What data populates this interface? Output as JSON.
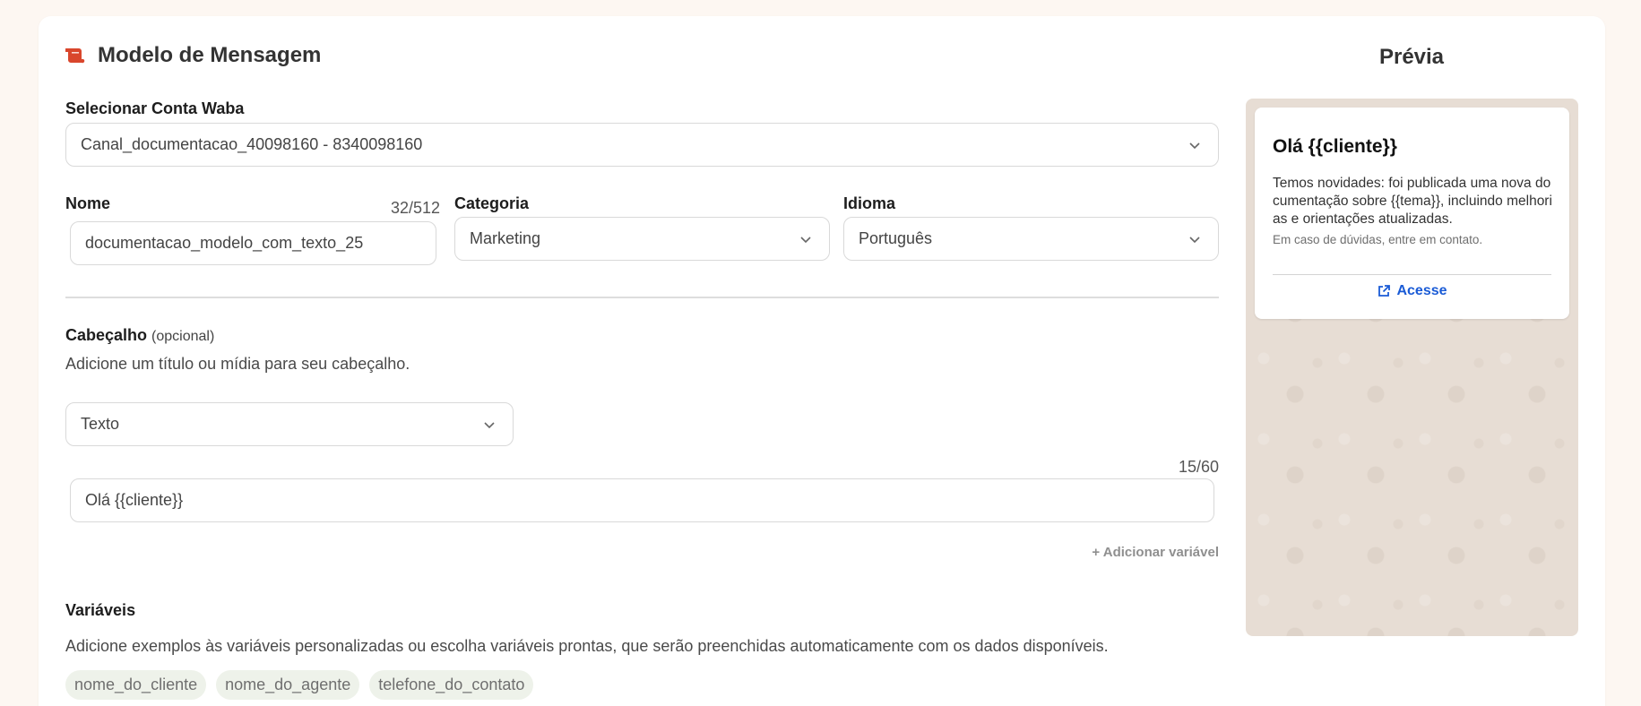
{
  "header": {
    "title": "Modelo de Mensagem",
    "preview_title": "Prévia"
  },
  "waba": {
    "label": "Selecionar Conta Waba",
    "value": "Canal_documentacao_40098160 - 8340098160"
  },
  "name_field": {
    "label": "Nome",
    "counter": "32/512",
    "value": "documentacao_modelo_com_texto_25"
  },
  "category": {
    "label": "Categoria",
    "value": "Marketing"
  },
  "language": {
    "label": "Idioma",
    "value": "Português"
  },
  "header_section": {
    "label": "Cabeçalho",
    "optional": "(opcional)",
    "help": "Adicione um título ou mídia para seu cabeçalho.",
    "type_value": "Texto",
    "counter": "15/60",
    "text_value": "Olá {{cliente}}",
    "add_variable": "+ Adicionar variável"
  },
  "variables": {
    "label": "Variáveis",
    "help": "Adicione exemplos às variáveis personalizadas ou escolha variáveis prontas, que serão preenchidas automaticamente com os dados disponíveis.",
    "chips": [
      "nome_do_cliente",
      "nome_do_agente",
      "telefone_do_contato"
    ]
  },
  "preview": {
    "bubble_title": "Olá {{cliente}}",
    "bubble_body": "Temos novidades: foi publicada uma nova documentação sobre {{tema}}, incluindo melhorias e orientações atualizadas.",
    "bubble_footer": "Em caso de dúvidas, entre em contato.",
    "button_label": "Acesse"
  },
  "colors": {
    "accent": "#d9462c",
    "link": "#1a5bd6",
    "background": "#fdf7f2",
    "chat_bg": "#e7ddd4"
  }
}
